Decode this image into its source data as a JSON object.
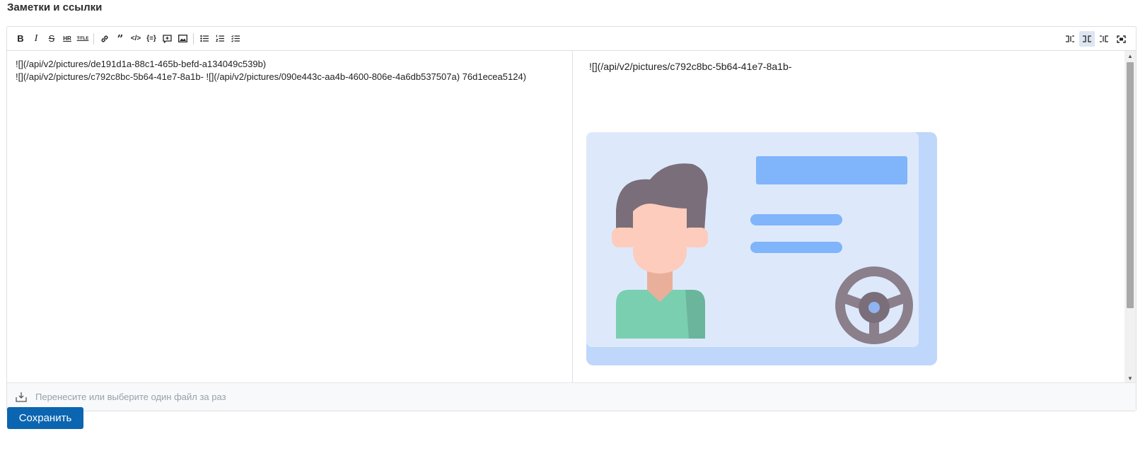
{
  "section": {
    "title": "Заметки и ссылки"
  },
  "toolbar": {
    "left": [
      {
        "name": "bold-button",
        "icon": "bold-icon",
        "glyph": "B"
      },
      {
        "name": "italic-button",
        "icon": "italic-icon",
        "glyph": "I"
      },
      {
        "name": "strikethrough-button",
        "icon": "strikethrough-icon",
        "glyph": "S"
      },
      {
        "name": "hr-button",
        "icon": "hr-icon",
        "glyph": "HR"
      },
      {
        "name": "title-button",
        "icon": "title-icon",
        "glyph": "TITLE"
      },
      {
        "name": "link-button",
        "icon": "link-icon",
        "glyph": ""
      },
      {
        "name": "quote-button",
        "icon": "quote-icon",
        "glyph": "❞"
      },
      {
        "name": "code-button",
        "icon": "code-icon",
        "glyph": "</>"
      },
      {
        "name": "code-block-button",
        "icon": "code-block-icon",
        "glyph": "{}"
      },
      {
        "name": "comment-button",
        "icon": "comment-icon",
        "glyph": ""
      },
      {
        "name": "image-button",
        "icon": "image-icon",
        "glyph": ""
      },
      {
        "name": "unordered-list-button",
        "icon": "unordered-list-icon",
        "glyph": ""
      },
      {
        "name": "ordered-list-button",
        "icon": "ordered-list-icon",
        "glyph": ""
      },
      {
        "name": "checklist-button",
        "icon": "checklist-icon",
        "glyph": ""
      }
    ],
    "right": [
      {
        "name": "edit-mode-button",
        "icon": "edit-mode-icon"
      },
      {
        "name": "split-mode-button",
        "icon": "split-mode-icon",
        "active": true
      },
      {
        "name": "preview-mode-button",
        "icon": "preview-mode-icon"
      },
      {
        "name": "fullscreen-button",
        "icon": "fullscreen-icon"
      }
    ]
  },
  "editor": {
    "lines": [
      "![](/api/v2/pictures/de191d1a-88c1-465b-befd-a134049c539b)",
      "![](/api/v2/pictures/c792c8bc-5b64-41e7-8a1b- ![](/api/v2/pictures/090e443c-aa4b-4600-806e-4a6db537507a) 76d1ecea5124)"
    ]
  },
  "preview": {
    "text": "![](/api/v2/pictures/c792c8bc-5b64-41e7-8a1b-",
    "image_icon": "driver-license-icon",
    "colors": {
      "card": "#bfd7fb",
      "card_inner": "#dde9fb",
      "bar": "#80b4fb",
      "hair": "#7a6e7a",
      "skin": "#fdccbc",
      "neck": "#eaaf9b",
      "shirt": "#7acfb0",
      "shirt_shade": "#6ab59b",
      "wheel": "#8a7f8a",
      "wheel_hub": "#7a6e7a",
      "wheel_center": "#90b4f0"
    }
  },
  "dropzone": {
    "text": "Перенесите или выберите один файл за раз",
    "icon": "upload-tray-icon"
  },
  "actions": {
    "save_label": "Сохранить"
  },
  "colors": {
    "accent": "#0b65b0",
    "border": "#dcdfe4"
  }
}
